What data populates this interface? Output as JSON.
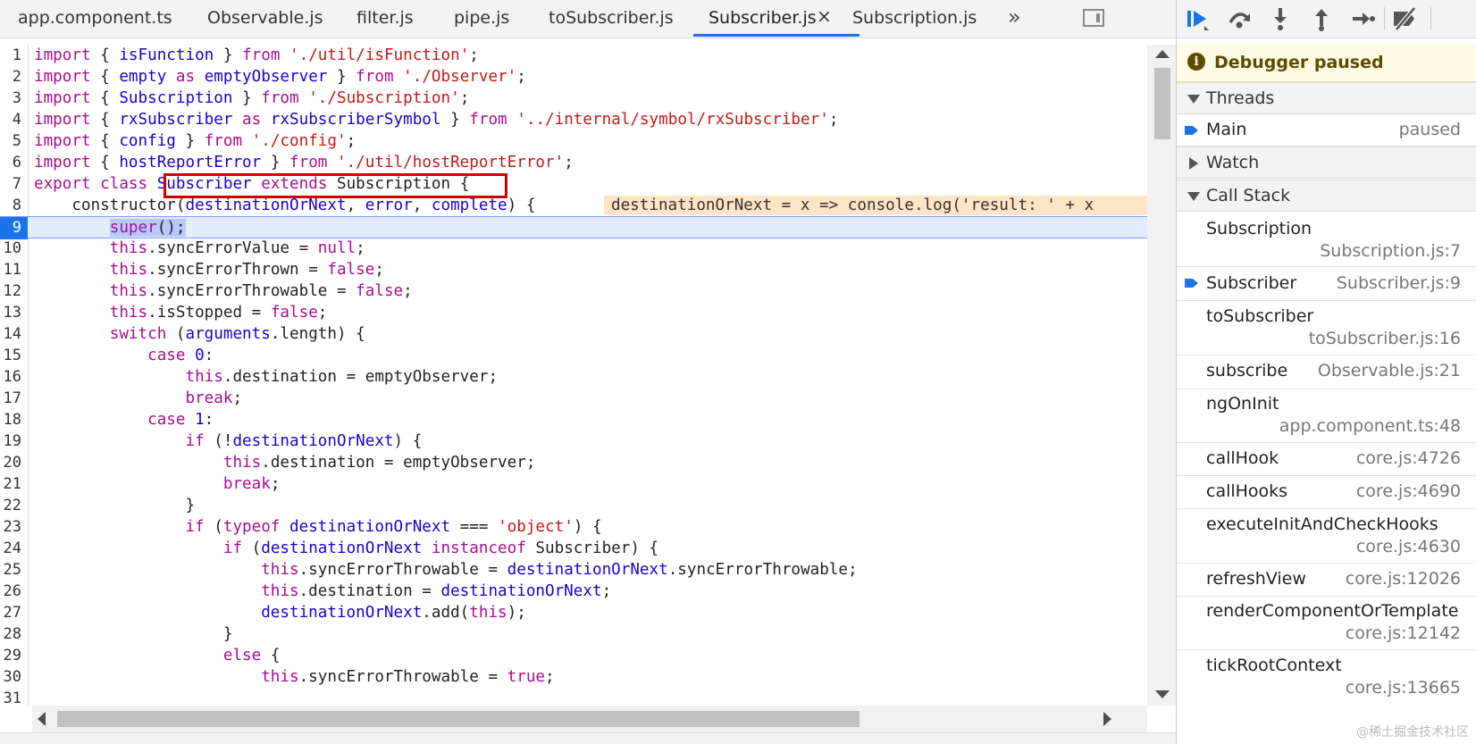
{
  "tabs": [
    {
      "label": "app.component.ts",
      "active": false
    },
    {
      "label": "Observable.js",
      "active": false
    },
    {
      "label": "filter.js",
      "active": false
    },
    {
      "label": "pipe.js",
      "active": false
    },
    {
      "label": "toSubscriber.js",
      "active": false
    },
    {
      "label": "Subscriber.js",
      "active": true
    },
    {
      "label": "Subscription.js",
      "active": false
    }
  ],
  "tab_close_glyph": "×",
  "tab_overflow_glyph": "»",
  "line_numbers": [
    "1",
    "2",
    "3",
    "4",
    "5",
    "6",
    "7",
    "8",
    "9",
    "10",
    "11",
    "12",
    "13",
    "14",
    "15",
    "16",
    "17",
    "18",
    "19",
    "20",
    "21",
    "22",
    "23",
    "24",
    "25",
    "26",
    "27",
    "28",
    "29",
    "30",
    "31"
  ],
  "current_line": "9",
  "inline_value": "destinationOrNext = x => console.log('result: ' + x",
  "debugger": {
    "paused_text": "Debugger paused",
    "info_glyph": "i",
    "threads_title": "Threads",
    "thread_name": "Main",
    "thread_status": "paused",
    "watch_title": "Watch",
    "callstack_title": "Call Stack",
    "frames": [
      {
        "name": "Subscription",
        "location": "Subscription.js:7"
      },
      {
        "name": "Subscriber",
        "location": "Subscriber.js:9"
      },
      {
        "name": "toSubscriber",
        "location": "toSubscriber.js:16"
      },
      {
        "name": "subscribe",
        "location": "Observable.js:21"
      },
      {
        "name": "ngOnInit",
        "location": "app.component.ts:48"
      },
      {
        "name": "callHook",
        "location": "core.js:4726"
      },
      {
        "name": "callHooks",
        "location": "core.js:4690"
      },
      {
        "name": "executeInitAndCheckHooks",
        "location": "core.js:4630"
      },
      {
        "name": "refreshView",
        "location": "core.js:12026"
      },
      {
        "name": "renderComponentOrTemplate",
        "location": "core.js:12142"
      },
      {
        "name": "tickRootContext",
        "location": "core.js:13665"
      }
    ]
  },
  "watermark": "@稀土掘金技术社区",
  "colors": {
    "accent": "#1a73e8",
    "paused_banner": "#fffbe5",
    "highlight_box": "#d00000"
  },
  "icons": [
    "resume-icon",
    "step-over-icon",
    "step-into-icon",
    "step-out-icon",
    "step-icon",
    "deactivate-breakpoints-icon"
  ]
}
